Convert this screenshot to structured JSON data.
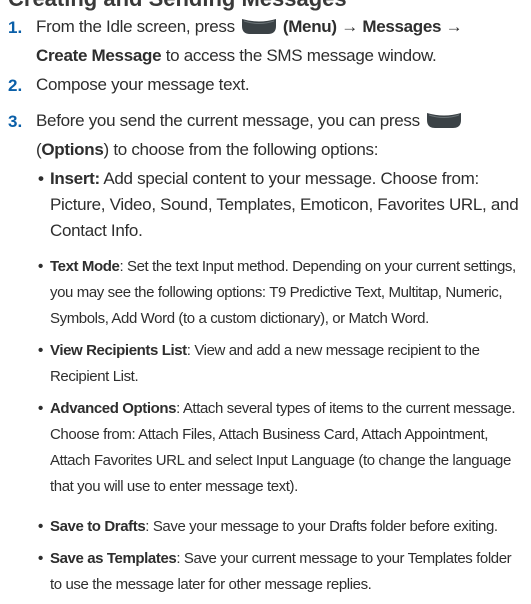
{
  "heading_fragment": "Creating and Sending Messages",
  "steps": [
    {
      "number": "1.",
      "pre": "From the Idle screen, press",
      "key1": "(Menu)",
      "arrow1": "→",
      "menu1": "Messages",
      "arrow2": "→",
      "menu2": "Create Message",
      "post": "to access the SMS message window."
    },
    {
      "number": "2.",
      "text": "Compose your message text."
    },
    {
      "number": "3.",
      "pre": "Before you send the current message, you can press",
      "key_open": "(",
      "key_label": "Options",
      "key_close": ")",
      "post": "to choose from the following options:"
    }
  ],
  "options": [
    {
      "title": "Insert:",
      "desc": "Add special content to your message. Choose from: Picture, Video, Sound, Templates, Emoticon, Favorites URL, and Contact Info."
    },
    {
      "title": "Text Mode",
      "desc": ": Set the text Input method. Depending on your current settings, you may see the following options: T9 Predictive Text, Multitap, Numeric, Symbols, Add Word (to a custom dictionary), or Match Word."
    },
    {
      "title": "View Recipients List",
      "desc": ": View and add a new message recipient to the Recipient List."
    },
    {
      "title": "Advanced Options",
      "desc": ": Attach several types of items to the current message. Choose from: Attach Files, Attach Business Card, Attach Appointment, Attach Favorites URL and select Input Language (to change the language that you will use to enter message text)."
    },
    {
      "title": "Save to Drafts",
      "desc": ": Save your message to your Drafts folder before exiting."
    },
    {
      "title": "Save as Templates",
      "desc": ": Save your current message to your Templates folder to use the message later for other message replies."
    }
  ],
  "icons": {
    "soft_key": "left-soft-key-icon"
  },
  "colors": {
    "step_number": "#0a5fa8",
    "body_text": "#2e2e2e"
  }
}
